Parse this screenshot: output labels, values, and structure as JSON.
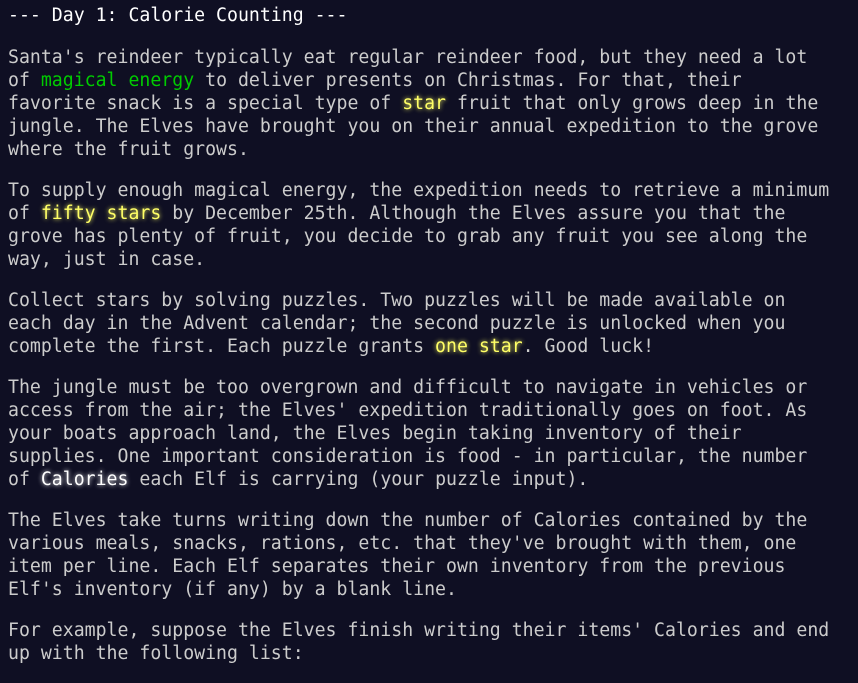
{
  "title": "--- Day 1: Calorie Counting ---",
  "paragraphs": [
    {
      "lines": [
        [
          {
            "text": "Santa's reindeer typically eat regular reindeer food, but they need a lot"
          }
        ],
        [
          {
            "text": "of "
          },
          {
            "text": "magical energy",
            "style": "green"
          },
          {
            "text": " to deliver presents on Christmas. For that, their"
          }
        ],
        [
          {
            "text": "favorite snack is a special type of "
          },
          {
            "text": "star",
            "style": "star"
          },
          {
            "text": " fruit that only grows deep in the"
          }
        ],
        [
          {
            "text": "jungle. The Elves have brought you on their annual expedition to the grove"
          }
        ],
        [
          {
            "text": "where the fruit grows."
          }
        ]
      ]
    },
    {
      "lines": [
        [
          {
            "text": "To supply enough magical energy, the expedition needs to retrieve a minimum"
          }
        ],
        [
          {
            "text": "of "
          },
          {
            "text": "fifty stars",
            "style": "star"
          },
          {
            "text": " by December 25th. Although the Elves assure you that the"
          }
        ],
        [
          {
            "text": "grove has plenty of fruit, you decide to grab any fruit you see along the"
          }
        ],
        [
          {
            "text": "way, just in case."
          }
        ]
      ]
    },
    {
      "lines": [
        [
          {
            "text": "Collect stars by solving puzzles. Two puzzles will be made available on"
          }
        ],
        [
          {
            "text": "each day in the Advent calendar; the second puzzle is unlocked when you"
          }
        ],
        [
          {
            "text": "complete the first. Each puzzle grants "
          },
          {
            "text": "one star",
            "style": "star"
          },
          {
            "text": ". Good luck!"
          }
        ]
      ]
    },
    {
      "lines": [
        [
          {
            "text": "The jungle must be too overgrown and difficult to navigate in vehicles or"
          }
        ],
        [
          {
            "text": "access from the air; the Elves' expedition traditionally goes on foot. As"
          }
        ],
        [
          {
            "text": "your boats approach land, the Elves begin taking inventory of their"
          }
        ],
        [
          {
            "text": "supplies. One important consideration is food - in particular, the number"
          }
        ],
        [
          {
            "text": "of "
          },
          {
            "text": "Calories",
            "style": "em"
          },
          {
            "text": " each Elf is carrying (your puzzle input)."
          }
        ]
      ]
    },
    {
      "lines": [
        [
          {
            "text": "The Elves take turns writing down the number of Calories contained by the"
          }
        ],
        [
          {
            "text": "various meals, snacks, rations, etc. that they've brought with them, one"
          }
        ],
        [
          {
            "text": "item per line. Each Elf separates their own inventory from the previous"
          }
        ],
        [
          {
            "text": "Elf's inventory (if any) by a blank line."
          }
        ]
      ]
    },
    {
      "lines": [
        [
          {
            "text": "For example, suppose the Elves finish writing their items' Calories and end"
          }
        ],
        [
          {
            "text": "up with the following list:"
          }
        ]
      ]
    }
  ],
  "colors": {
    "background": "#0f0f23",
    "text": "#cccccc",
    "title": "#ffffff",
    "green": "#00cc00",
    "star": "#ffff66"
  }
}
